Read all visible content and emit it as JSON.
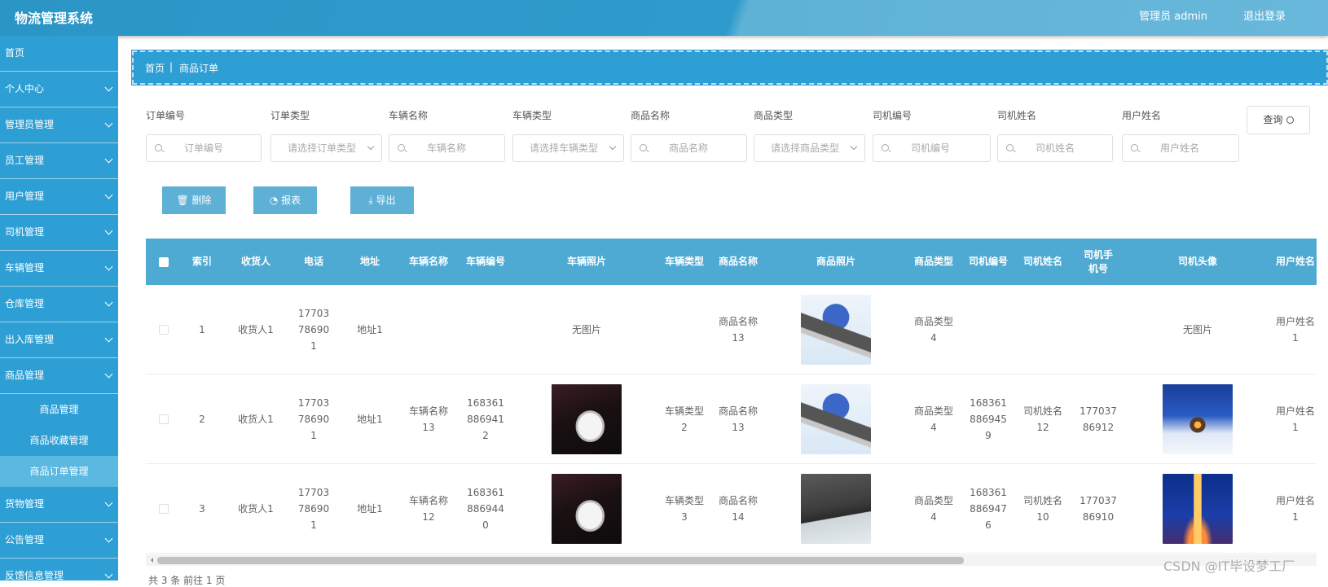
{
  "header": {
    "title": "物流管理系统",
    "user": "管理员 admin",
    "logout": "退出登录"
  },
  "sidebar": {
    "items": [
      {
        "label": "首页",
        "chevron": false
      },
      {
        "label": "个人中心",
        "chevron": true
      },
      {
        "label": "管理员管理",
        "chevron": true
      },
      {
        "label": "员工管理",
        "chevron": true
      },
      {
        "label": "用户管理",
        "chevron": true
      },
      {
        "label": "司机管理",
        "chevron": true
      },
      {
        "label": "车辆管理",
        "chevron": true
      },
      {
        "label": "仓库管理",
        "chevron": true
      },
      {
        "label": "出入库管理",
        "chevron": true
      },
      {
        "label": "商品管理",
        "chevron": true
      }
    ],
    "sub_items": [
      "商品管理",
      "商品收藏管理",
      "商品订单管理"
    ],
    "active_sub": "商品订单管理",
    "items_after": [
      "货物管理",
      "公告管理",
      "反馈信息管理"
    ]
  },
  "breadcrumb": {
    "home": "首页",
    "separator": "|",
    "current": "商品订单"
  },
  "filters": [
    {
      "label": "订单编号",
      "placeholder": "订单编号",
      "type": "search"
    },
    {
      "label": "订单类型",
      "placeholder": "请选择订单类型",
      "type": "select"
    },
    {
      "label": "车辆名称",
      "placeholder": "车辆名称",
      "type": "search"
    },
    {
      "label": "车辆类型",
      "placeholder": "请选择车辆类型",
      "type": "select"
    },
    {
      "label": "商品名称",
      "placeholder": "商品名称",
      "type": "search"
    },
    {
      "label": "商品类型",
      "placeholder": "请选择商品类型",
      "type": "select"
    },
    {
      "label": "司机编号",
      "placeholder": "司机编号",
      "type": "search"
    },
    {
      "label": "司机姓名",
      "placeholder": "司机姓名",
      "type": "search"
    },
    {
      "label": "用户姓名",
      "placeholder": "用户姓名",
      "type": "search"
    }
  ],
  "query_button": "查询",
  "actions": {
    "delete": "删除",
    "report": "报表",
    "export": "导出"
  },
  "table": {
    "columns": [
      "",
      "索引",
      "收货人",
      "电话",
      "地址",
      "车辆名称",
      "车辆编号",
      "车辆照片",
      "车辆类型",
      "商品名称",
      "商品照片",
      "商品类型",
      "司机编号",
      "司机姓名",
      "司机手机号",
      "司机头像",
      "用户姓名"
    ],
    "rows": [
      {
        "index": "1",
        "receiver": "收货人1",
        "phone": "17703786901",
        "address": "地址1",
        "vehicle_name": "",
        "vehicle_no": "",
        "vehicle_photo": "无图片",
        "vehicle_type": "",
        "goods_name": "商品名称13",
        "goods_photo": "laptop",
        "goods_type": "商品类型4",
        "driver_no": "",
        "driver_name": "",
        "driver_phone": "",
        "driver_avatar": "无图片",
        "user_name": "用户姓名1"
      },
      {
        "index": "2",
        "receiver": "收货人1",
        "phone": "17703786901",
        "address": "地址1",
        "vehicle_name": "车辆名称13",
        "vehicle_no": "1683618869412",
        "vehicle_photo": "car",
        "vehicle_type": "车辆类型2",
        "goods_name": "商品名称13",
        "goods_photo": "laptop",
        "goods_type": "商品类型4",
        "driver_no": "1683618869459",
        "driver_name": "司机姓名12",
        "driver_phone": "17703786912",
        "driver_avatar": "snow",
        "user_name": "用户姓名1"
      },
      {
        "index": "3",
        "receiver": "收货人1",
        "phone": "17703786901",
        "address": "地址1",
        "vehicle_name": "车辆名称12",
        "vehicle_no": "1683618869440",
        "vehicle_photo": "car",
        "vehicle_type": "车辆类型3",
        "goods_name": "商品名称14",
        "goods_photo": "laptop2",
        "goods_type": "商品类型4",
        "driver_no": "1683618869476",
        "driver_name": "司机姓名10",
        "driver_phone": "17703786910",
        "driver_avatar": "tower",
        "user_name": "用户姓名1"
      }
    ]
  },
  "pagination": {
    "text": "共 3 条  前往  1  页"
  },
  "watermark": "CSDN @IT毕设梦工厂"
}
